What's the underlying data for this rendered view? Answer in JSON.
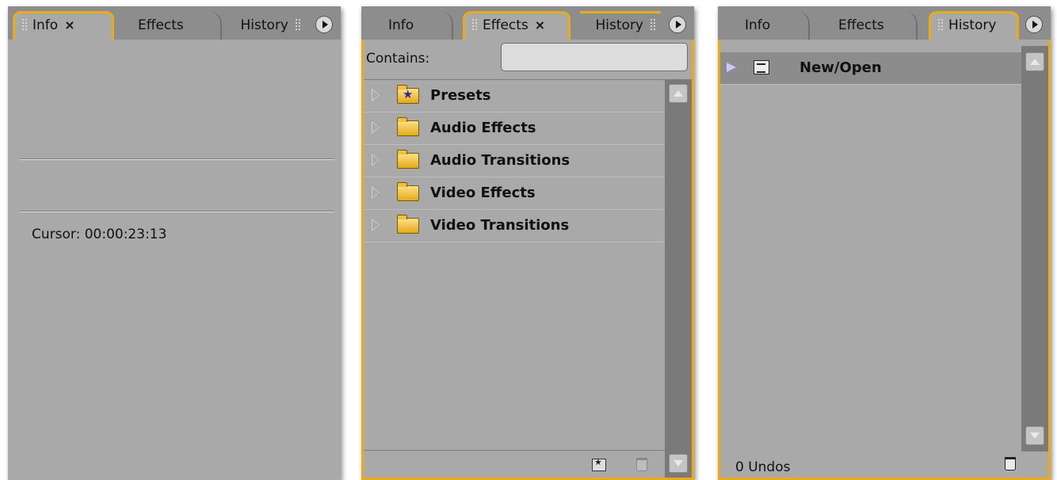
{
  "colors": {
    "panel_bg": "#a9a9a9",
    "tab_bar": "#8d8d8d",
    "focus_accent": "#e7ab1b",
    "scrollbar": "#7a7a7a"
  },
  "info_panel": {
    "tabs": [
      {
        "label": "Info",
        "close": "×"
      },
      {
        "label": "Effects"
      },
      {
        "label": "History"
      }
    ],
    "cursor_text": "Cursor: 00:00:23:13"
  },
  "effects_panel": {
    "tabs": [
      {
        "label": "Info"
      },
      {
        "label": "Effects",
        "close": "×"
      },
      {
        "label": "History"
      }
    ],
    "contains_label": "Contains:",
    "search_value": "",
    "tree": [
      {
        "label": "Presets",
        "icon": "preset-folder-icon"
      },
      {
        "label": "Audio Effects",
        "icon": "folder-icon"
      },
      {
        "label": "Audio Transitions",
        "icon": "folder-icon"
      },
      {
        "label": "Video Effects",
        "icon": "folder-icon"
      },
      {
        "label": "Video Transitions",
        "icon": "folder-icon"
      }
    ]
  },
  "history_panel": {
    "tabs": [
      {
        "label": "Info"
      },
      {
        "label": "Effects"
      },
      {
        "label": "History"
      }
    ],
    "items": [
      {
        "label": "New/Open"
      }
    ],
    "undo_count": "0 Undos"
  }
}
